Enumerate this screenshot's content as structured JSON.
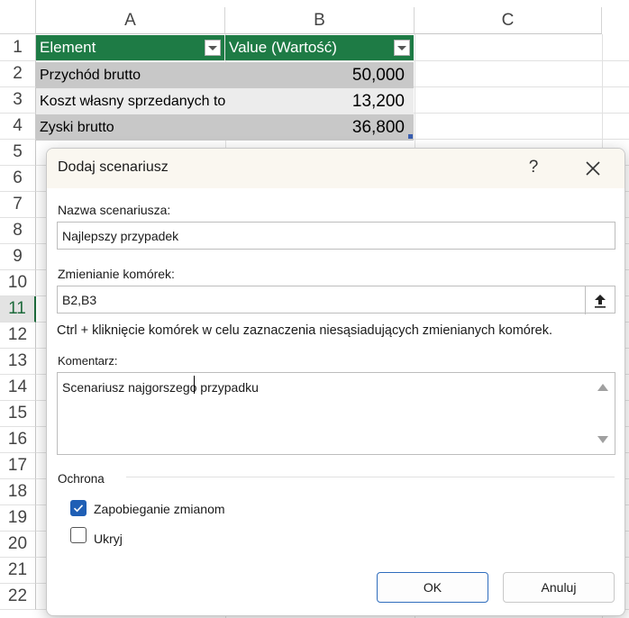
{
  "sheet": {
    "columns": [
      "A",
      "B",
      "C"
    ],
    "rows": [
      "1",
      "2",
      "3",
      "4",
      "5",
      "6",
      "7",
      "8",
      "9",
      "10",
      "11",
      "12",
      "13",
      "14",
      "15",
      "16",
      "17",
      "18",
      "19",
      "20",
      "21",
      "22"
    ],
    "active_row": "11",
    "table": {
      "header": {
        "a": "Element",
        "b": "Value (Wartość)"
      },
      "body": [
        {
          "a": "Przychód brutto",
          "b": "50,000"
        },
        {
          "a": "Koszt własny sprzedanych towarów",
          "b": "13,200"
        },
        {
          "a": "Zyski brutto",
          "b": "36,800"
        }
      ],
      "header_color": "#1e7b45"
    }
  },
  "dialog": {
    "title": "Dodaj scenariusz",
    "help_label": "?",
    "scenario_name": {
      "label": "Nazwa scenariusza:",
      "value": "Najlepszy przypadek"
    },
    "changing_cells": {
      "label": "Zmienianie komórek:",
      "value": "B2,B3",
      "hint": "Ctrl + kliknięcie komórek w celu zaznaczenia niesąsiadujących zmienianych komórek."
    },
    "comment": {
      "label": "Komentarz:",
      "value": "Scenariusz najgorszego przypadku"
    },
    "protection": {
      "group_label": "Ochrona",
      "prevent_changes": {
        "label": "Zapobieganie zmianom",
        "checked": true
      },
      "hide": {
        "label": "Ukryj",
        "checked": false
      }
    },
    "ok_label": "OK",
    "cancel_label": "Anuluj",
    "accent_color": "#1f5fb5"
  }
}
